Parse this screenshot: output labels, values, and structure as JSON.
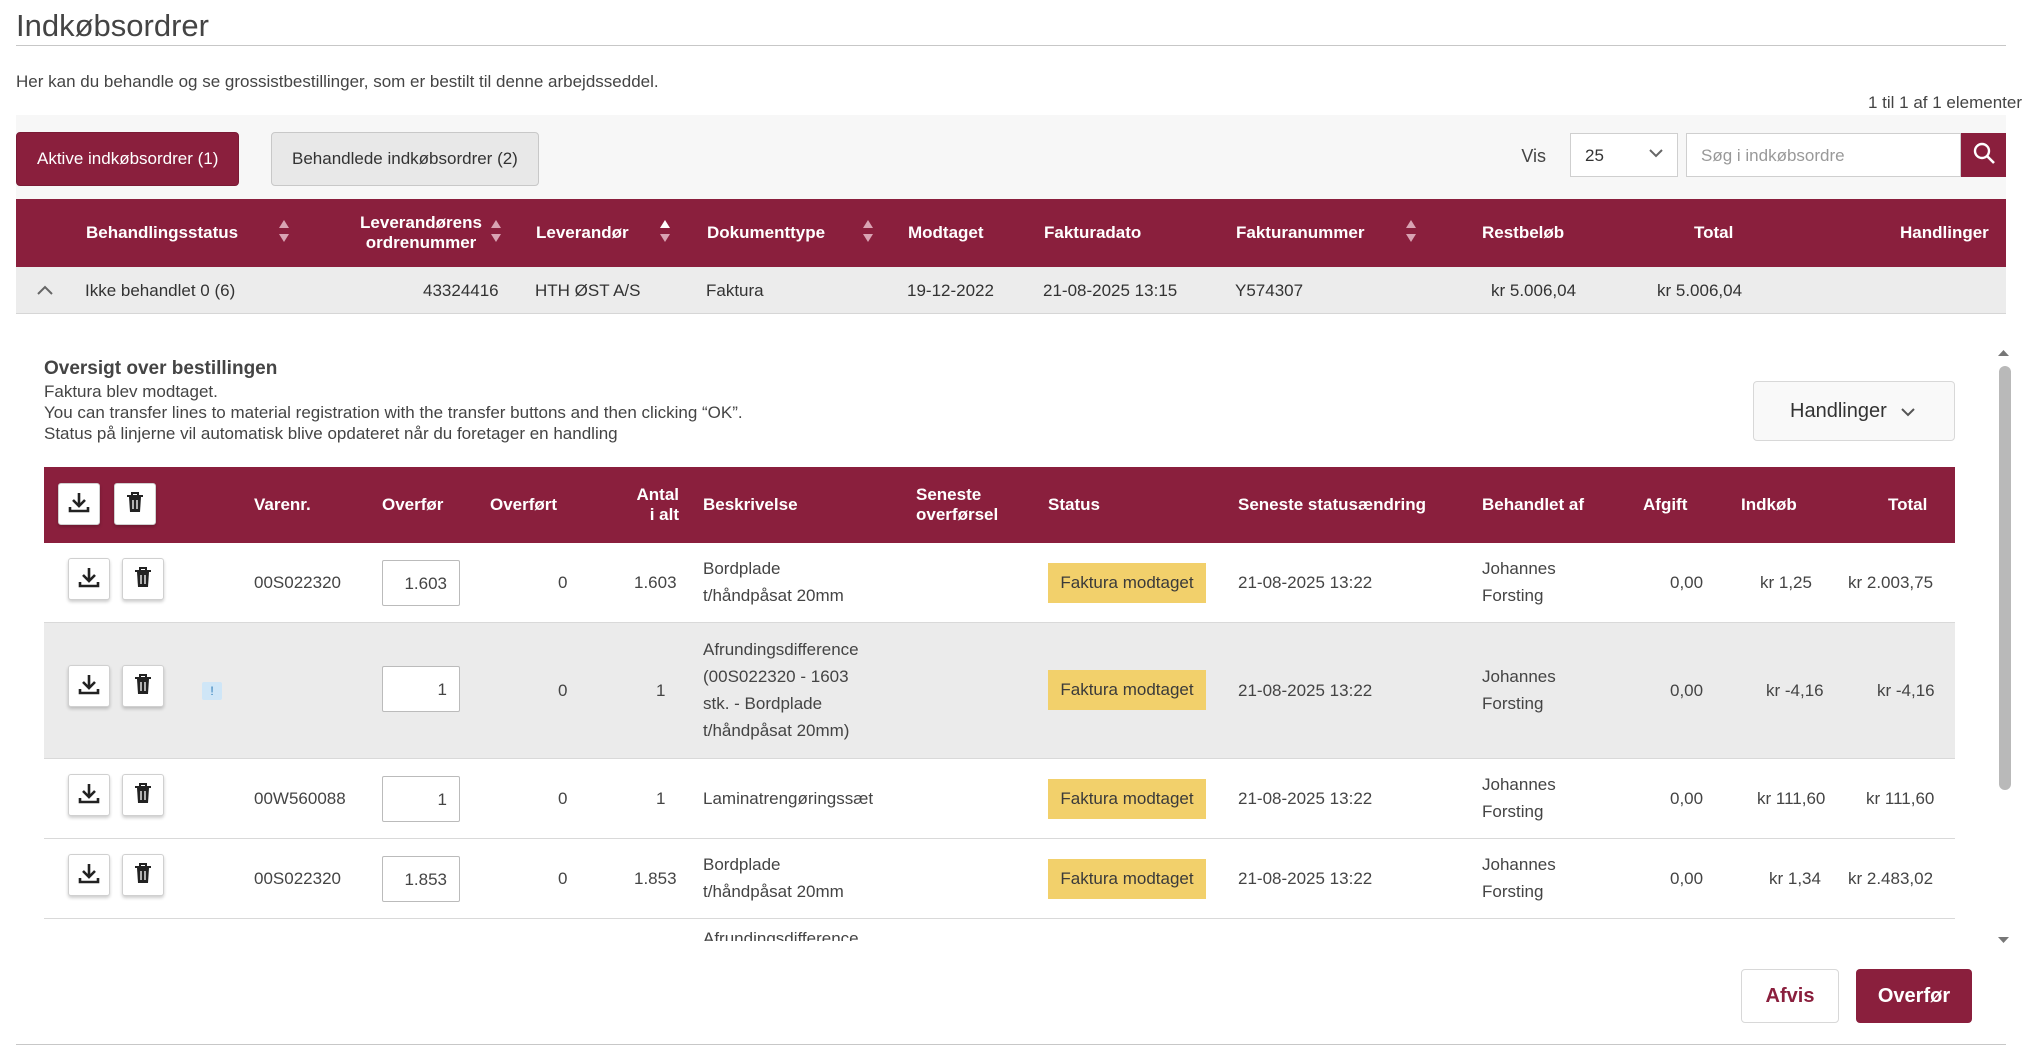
{
  "page": {
    "title": "Indkøbsordrer",
    "intro": "Her kan du behandle og se grossistbestillinger, som er bestilt til denne arbejdsseddel.",
    "count": "1 til 1 af 1 elementer"
  },
  "toolbar": {
    "tab_active": "Aktive indkøbsordrer (1)",
    "tab_inactive": "Behandlede indkøbsordrer (2)",
    "vis_label": "Vis",
    "vis_value": "25",
    "search_placeholder": "Søg i indkøbsordre"
  },
  "main_table": {
    "headers": {
      "status": "Behandlingsstatus",
      "ordernr_1": "Leverandørens",
      "ordernr_2": "ordrenummer",
      "supplier": "Leverandør",
      "doctype": "Dokumenttype",
      "received": "Modtaget",
      "invdate": "Fakturadato",
      "invnr": "Fakturanummer",
      "rest": "Restbeløb",
      "total": "Total",
      "actions": "Handlinger"
    },
    "row": {
      "status": "Ikke behandlet 0 (6)",
      "ordernr": "43324416",
      "supplier": "HTH ØST A/S",
      "doctype": "Faktura",
      "received": "19-12-2022",
      "invdate": "21-08-2025 13:15",
      "invnr": "Y574307",
      "rest": "kr 5.006,04",
      "total": "kr 5.006,04"
    }
  },
  "overview": {
    "title": "Oversigt over bestillingen",
    "line1": "Faktura blev modtaget.",
    "line2": "You can transfer lines to material registration with the transfer buttons and then clicking “OK”.",
    "line3": "Status på linjerne vil automatisk blive opdateret når du foretager en handling",
    "actions_button": "Handlinger"
  },
  "detail_table": {
    "headers": {
      "varenr": "Varenr.",
      "overfoer": "Overfør",
      "overfoert": "Overført",
      "antal_1": "Antal",
      "antal_2": "i alt",
      "beskrivelse": "Beskrivelse",
      "seneste_1": "Seneste",
      "seneste_2": "overførsel",
      "status": "Status",
      "statusaendring": "Seneste statusændring",
      "behandlet": "Behandlet af",
      "afgift": "Afgift",
      "indkoeb": "Indkøb",
      "total": "Total"
    },
    "rows": [
      {
        "varenr": "00S022320",
        "overfoer": "1.603",
        "overfoert": "0",
        "antal": "1.603",
        "desc": [
          "Bordplade",
          "t/håndpåsat 20mm"
        ],
        "status": "Faktura modtaget",
        "changed": "21-08-2025 13:22",
        "by": [
          "Johannes",
          "Forsting"
        ],
        "afgift": "0,00",
        "indkoeb": "kr 1,25",
        "total": "kr 2.003,75"
      },
      {
        "varenr": "",
        "warn": "!",
        "overfoer": "1",
        "overfoert": "0",
        "antal": "1",
        "desc": [
          "Afrundingsdifference",
          "(00S022320 - 1603",
          "stk. - Bordplade",
          "t/håndpåsat 20mm)"
        ],
        "status": "Faktura modtaget",
        "changed": "21-08-2025 13:22",
        "by": [
          "Johannes",
          "Forsting"
        ],
        "afgift": "0,00",
        "indkoeb": "kr -4,16",
        "total": "kr -4,16"
      },
      {
        "varenr": "00W560088",
        "overfoer": "1",
        "overfoert": "0",
        "antal": "1",
        "desc": [
          "Laminatrengøringssæt"
        ],
        "status": "Faktura modtaget",
        "changed": "21-08-2025 13:22",
        "by": [
          "Johannes",
          "Forsting"
        ],
        "afgift": "0,00",
        "indkoeb": "kr 111,60",
        "total": "kr 111,60"
      },
      {
        "varenr": "00S022320",
        "overfoer": "1.853",
        "overfoert": "0",
        "antal": "1.853",
        "desc": [
          "Bordplade",
          "t/håndpåsat 20mm"
        ],
        "status": "Faktura modtaget",
        "changed": "21-08-2025 13:22",
        "by": [
          "Johannes",
          "Forsting"
        ],
        "afgift": "0,00",
        "indkoeb": "kr 1,34",
        "total": "kr 2.483,02"
      },
      {
        "desc": [
          "Afrundingsdifference"
        ]
      }
    ]
  },
  "footer_buttons": {
    "afvis": "Afvis",
    "overfoer": "Overfør"
  },
  "colors": {
    "brand": "#8a1f3d",
    "status_badge": "#f2d06b"
  }
}
